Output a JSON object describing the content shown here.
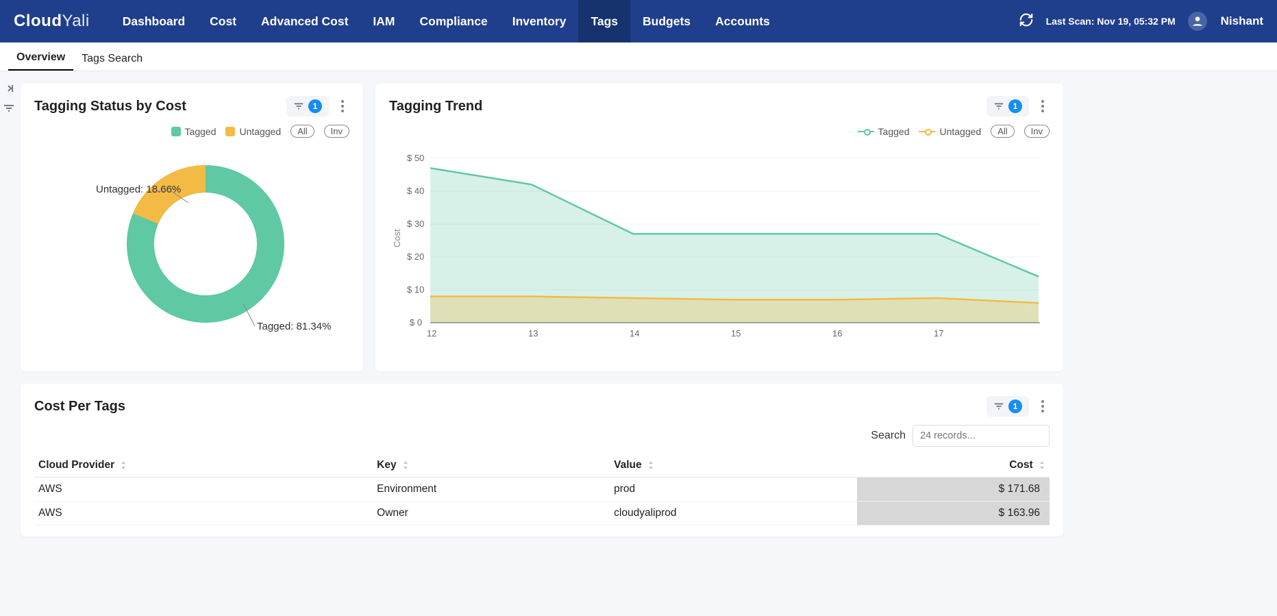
{
  "brand": {
    "part1": "Cloud",
    "part2": "Yali"
  },
  "nav": {
    "items": [
      "Dashboard",
      "Cost",
      "Advanced Cost",
      "IAM",
      "Compliance",
      "Inventory",
      "Tags",
      "Budgets",
      "Accounts"
    ],
    "active": "Tags"
  },
  "header": {
    "last_scan": "Last Scan: Nov 19, 05:32 PM",
    "user": "Nishant"
  },
  "subtabs": {
    "items": [
      "Overview",
      "Tags Search"
    ],
    "active": "Overview"
  },
  "cards": {
    "donut": {
      "title": "Tagging Status by Cost",
      "filter_badge": "1",
      "legend": {
        "tagged": "Tagged",
        "untagged": "Untagged",
        "all": "All",
        "inv": "Inv"
      },
      "labels": {
        "tagged": "Tagged: 81.34%",
        "untagged": "Untagged: 18.66%"
      }
    },
    "trend": {
      "title": "Tagging Trend",
      "filter_badge": "1",
      "legend": {
        "tagged": "Tagged",
        "untagged": "Untagged",
        "all": "All",
        "inv": "Inv"
      },
      "ylabel": "Cost",
      "yticks": [
        "$ 0",
        "$ 10",
        "$ 20",
        "$ 30",
        "$ 40",
        "$ 50"
      ],
      "xticks": [
        "12",
        "13",
        "14",
        "15",
        "16",
        "17"
      ]
    },
    "table": {
      "title": "Cost Per Tags",
      "filter_badge": "1",
      "search_label": "Search",
      "search_placeholder": "24 records...",
      "columns": [
        "Cloud Provider",
        "Key",
        "Value",
        "Cost"
      ],
      "rows": [
        {
          "provider": "AWS",
          "key": "Environment",
          "value": "prod",
          "cost": "$ 171.68"
        },
        {
          "provider": "AWS",
          "key": "Owner",
          "value": "cloudyaliprod",
          "cost": "$ 163.96"
        }
      ]
    }
  },
  "chart_data": [
    {
      "type": "pie",
      "title": "Tagging Status by Cost",
      "series": [
        {
          "name": "Tagged",
          "value": 81.34,
          "color": "#5ec9a3"
        },
        {
          "name": "Untagged",
          "value": 18.66,
          "color": "#f3bb44"
        }
      ]
    },
    {
      "type": "area",
      "title": "Tagging Trend",
      "xlabel": "",
      "ylabel": "Cost",
      "ylim": [
        0,
        50
      ],
      "x": [
        12,
        13,
        14,
        15,
        16,
        17,
        18
      ],
      "series": [
        {
          "name": "Tagged",
          "color": "#5ec9a3",
          "values": [
            47,
            42,
            27,
            27,
            27,
            27,
            14
          ]
        },
        {
          "name": "Untagged",
          "color": "#f3bb44",
          "values": [
            8,
            8,
            7.5,
            7,
            7,
            7.5,
            6
          ]
        }
      ]
    }
  ]
}
